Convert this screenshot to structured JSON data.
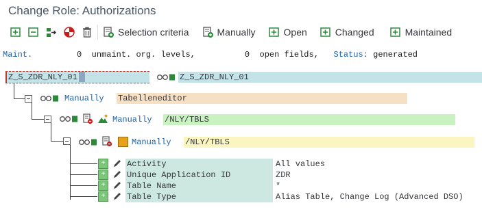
{
  "window": {
    "title": "Change Role: Authorizations"
  },
  "toolbar": {
    "buttons": [
      {
        "name": "expand-button",
        "icon": "expand-subtree-icon",
        "label": ""
      },
      {
        "name": "collapse-button",
        "icon": "collapse-subtree-icon",
        "label": ""
      },
      {
        "name": "move-button",
        "icon": "move-icon",
        "label": ""
      },
      {
        "name": "deactivate-button",
        "icon": "deactivate-icon",
        "label": ""
      },
      {
        "name": "delete-button",
        "icon": "trash-icon",
        "label": ""
      },
      {
        "name": "selection-criteria-button",
        "icon": "add-document-icon",
        "label": "Selection criteria"
      },
      {
        "name": "manually-button",
        "icon": "add-document-icon",
        "label": "Manually"
      },
      {
        "name": "open-button",
        "icon": "open-icon",
        "label": "Open"
      },
      {
        "name": "changed-button",
        "icon": "changed-icon",
        "label": "Changed"
      },
      {
        "name": "maintained-button",
        "icon": "maintained-icon",
        "label": "Maintained"
      }
    ]
  },
  "status": {
    "maint_label": "Maint.",
    "unmaint_count": "0",
    "unmaint_label": "unmaint. org. levels,",
    "open_count": "0",
    "open_label": "open fields,",
    "status_label": "Status:",
    "status_value": "generated"
  },
  "tree": {
    "root": {
      "name": "Z_S_ZDR_NLY_01",
      "desc": "Z_S_ZDR_NLY_01"
    },
    "level1": {
      "state": "Manually",
      "text": "Tabelleneditor"
    },
    "level2": {
      "state": "Manually",
      "text": "/NLY/TBLS"
    },
    "level3": {
      "state": "Manually",
      "text": "/NLY/TBLS"
    },
    "fields": [
      {
        "name": "Activity",
        "value": "All values"
      },
      {
        "name": "Unique Application ID",
        "value": "ZDR"
      },
      {
        "name": "Table Name",
        "value": "*"
      },
      {
        "name": "Table Type",
        "value": "Alias Table, Change Log (Advanced DSO)"
      }
    ]
  },
  "colors": {
    "root_bg": "#c4e3e9",
    "level1_bg": "#f7dfc4",
    "level2_bg": "#c9f2c0",
    "level3_bg": "#fbf6c0",
    "field_bg": "#cce8e0",
    "link": "#1a63b0"
  }
}
